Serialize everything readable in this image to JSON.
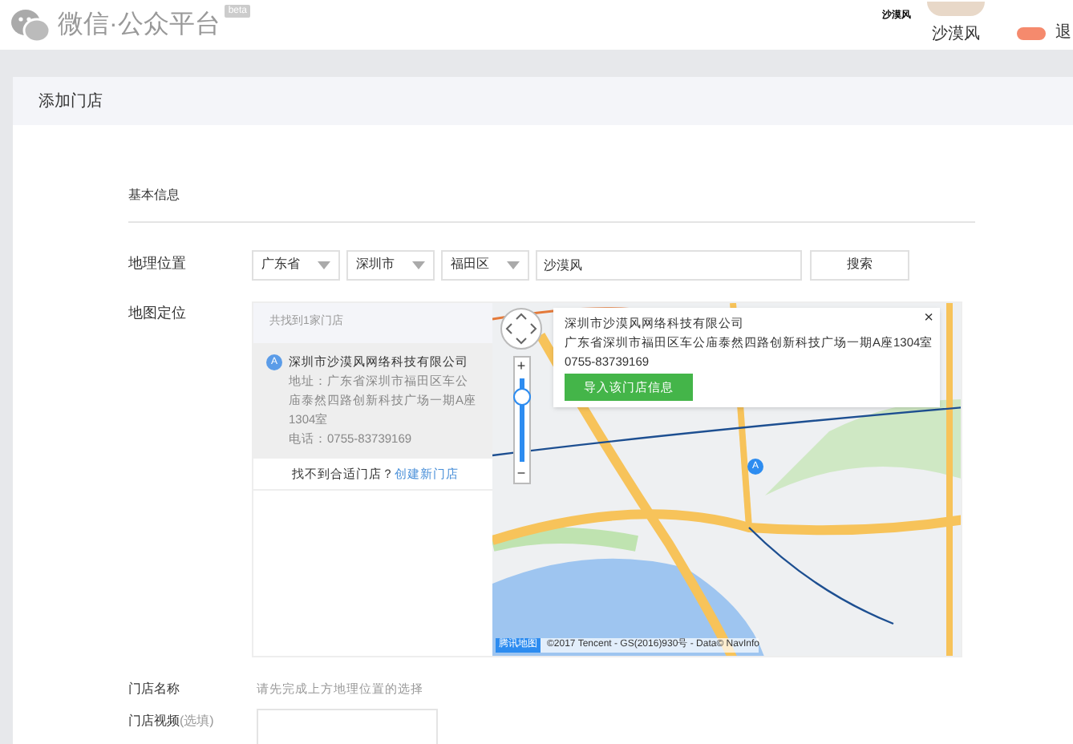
{
  "header": {
    "brand": "微信·公众平台",
    "beta_tag": "beta",
    "account_logo": "沙漠风",
    "user_name": "沙漠风",
    "logout": "退"
  },
  "page_title": "添加门店",
  "section_title": "基本信息",
  "location": {
    "label": "地理位置",
    "selects": [
      "广东省",
      "深圳市",
      "福田区"
    ],
    "search_value": "沙漠风",
    "search_button": "搜索"
  },
  "map_section": {
    "label": "地图定位",
    "result_count": "共找到1家门店",
    "results": [
      {
        "marker": "A",
        "name": "深圳市沙漠风网络科技有限公司",
        "address": "地址：广东省深圳市福田区车公庙泰然四路创新科技广场一期A座1304室",
        "phone": "电话：0755-83739169",
        "selected": true
      }
    ],
    "not_found_text": "找不到合适门店？",
    "create_link": "创建新门店",
    "popup": {
      "name": "深圳市沙漠风网络科技有限公司",
      "address": "广东省深圳市福田区车公庙泰然四路创新科技广场一期A座1304室",
      "phone": "0755-83739169",
      "import_button": "导入该门店信息",
      "close": "×"
    },
    "zoom": {
      "plus": "+",
      "minus": "−",
      "level": 0.78
    },
    "pin_marker": "A",
    "attribution": {
      "logo_text": "腾讯地图",
      "text": "©2017 Tencent - GS(2016)930号 - Data© NavInfo"
    }
  },
  "store_name": {
    "label": "门店名称",
    "hint": "请先完成上方地理位置的选择"
  },
  "store_video": {
    "label": "门店视频",
    "optional": "(选填)"
  }
}
